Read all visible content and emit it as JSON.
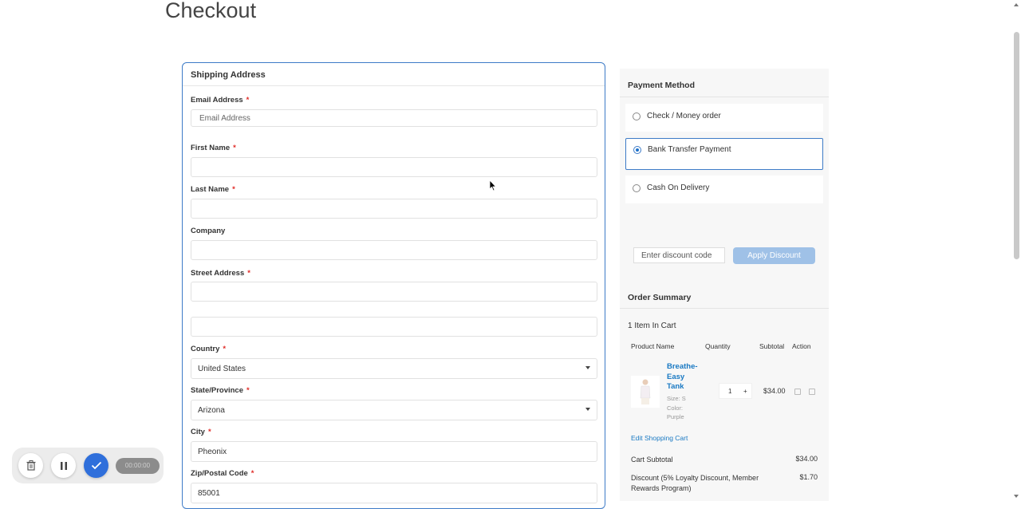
{
  "page": {
    "title": "Checkout"
  },
  "shipping": {
    "heading": "Shipping Address",
    "fields": {
      "email": {
        "label": "Email Address",
        "placeholder": "Email Address",
        "required": true
      },
      "first_name": {
        "label": "First Name",
        "value": "",
        "required": true
      },
      "last_name": {
        "label": "Last Name",
        "value": "",
        "required": true
      },
      "company": {
        "label": "Company",
        "value": ""
      },
      "street": {
        "label": "Street Address",
        "value": "",
        "line2": "",
        "required": true
      },
      "country": {
        "label": "Country",
        "value": "United States",
        "required": true
      },
      "state": {
        "label": "State/Province",
        "value": "Arizona",
        "required": true
      },
      "city": {
        "label": "City",
        "value": "Pheonix",
        "required": true
      },
      "zip": {
        "label": "Zip/Postal Code",
        "value": "85001",
        "required": true
      }
    },
    "required_mark": "*"
  },
  "payment": {
    "heading": "Payment Method",
    "options": [
      {
        "label": "Check / Money order",
        "selected": false
      },
      {
        "label": "Bank Transfer Payment",
        "selected": true
      },
      {
        "label": "Cash On Delivery",
        "selected": false
      }
    ],
    "discount": {
      "placeholder": "Enter discount code",
      "button": "Apply Discount"
    }
  },
  "order_summary": {
    "heading": "Order Summary",
    "items_count": "1 Item In Cart",
    "columns": [
      "Product Name",
      "Quantity",
      "Subtotal",
      "Action"
    ],
    "items": [
      {
        "name": "Breathe-Easy Tank",
        "name_lines": [
          "Breathe-",
          "Easy",
          "Tank"
        ],
        "size": "Size: S",
        "color_label": "Color:",
        "color": "Purple",
        "qty": "1",
        "qty_plus": "+",
        "subtotal": "$34.00"
      }
    ],
    "edit_cart": "Edit Shopping Cart",
    "totals": [
      {
        "label": "Cart Subtotal",
        "value": "$34.00"
      },
      {
        "label": "Discount (5% Loyalty Discount, Member Rewards Program)",
        "value": "$1.70"
      }
    ]
  },
  "recorder": {
    "pill_text": "00:00:00"
  },
  "colors": {
    "accent": "#3d7bc7",
    "link": "#1979c3",
    "button_disabled": "#9fc1e7",
    "required": "#e02b27"
  }
}
